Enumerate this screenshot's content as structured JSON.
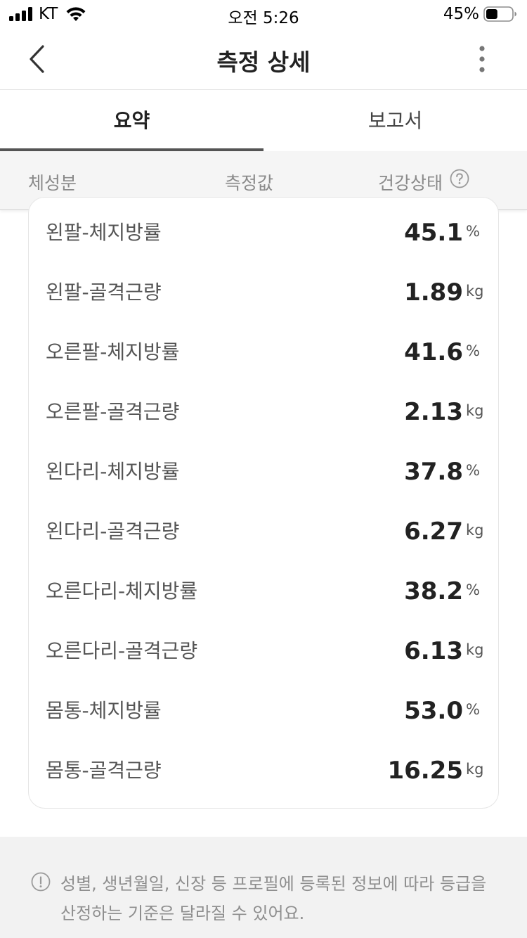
{
  "status_bar": {
    "carrier": "KT",
    "time": "오전 5:26",
    "battery_percent": "45%",
    "battery_level": 0.45
  },
  "nav": {
    "title": "측정 상세"
  },
  "tabs": [
    {
      "label": "요약",
      "active": true
    },
    {
      "label": "보고서",
      "active": false
    }
  ],
  "columns": {
    "body": "체성분",
    "value": "측정값",
    "status": "건강상태"
  },
  "rows": [
    {
      "label": "왼팔-체지방률",
      "value": "45.1",
      "unit": "%"
    },
    {
      "label": "왼팔-골격근량",
      "value": "1.89",
      "unit": "kg"
    },
    {
      "label": "오른팔-체지방률",
      "value": "41.6",
      "unit": "%"
    },
    {
      "label": "오른팔-골격근량",
      "value": "2.13",
      "unit": "kg"
    },
    {
      "label": "왼다리-체지방률",
      "value": "37.8",
      "unit": "%"
    },
    {
      "label": "왼다리-골격근량",
      "value": "6.27",
      "unit": "kg"
    },
    {
      "label": "오른다리-체지방률",
      "value": "38.2",
      "unit": "%"
    },
    {
      "label": "오른다리-골격근량",
      "value": "6.13",
      "unit": "kg"
    },
    {
      "label": "몸통-체지방률",
      "value": "53.0",
      "unit": "%"
    },
    {
      "label": "몸통-골격근량",
      "value": "16.25",
      "unit": "kg"
    }
  ],
  "info": {
    "text": "성별, 생년월일, 신장 등 프로필에 등록된 정보에 따라 등급을 산정하는 기준은 달라질 수 있어요."
  },
  "icons": {
    "back": "chevron-left-icon",
    "more": "more-vertical-icon",
    "help": "question-circle-icon",
    "info": "exclamation-circle-icon"
  },
  "colors": {
    "tab_indicator": "#555555",
    "header_bg": "#f5f5f5",
    "info_bg": "#f2f2f2",
    "muted_text": "#8e8e8e"
  }
}
